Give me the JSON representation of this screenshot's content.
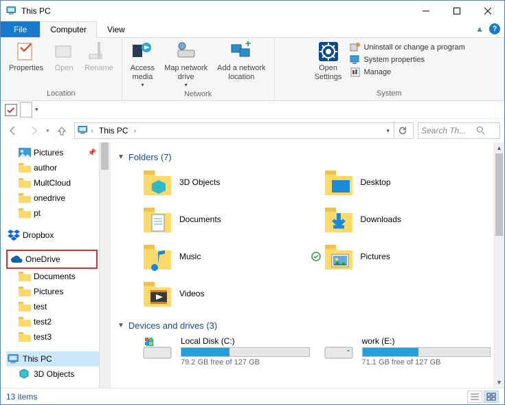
{
  "title": "This PC",
  "tabs": {
    "file": "File",
    "computer": "Computer",
    "view": "View"
  },
  "ribbon": {
    "location": {
      "label": "Location",
      "properties": "Properties",
      "open": "Open",
      "rename": "Rename"
    },
    "network": {
      "label": "Network",
      "access_media": "Access\nmedia",
      "map_drive": "Map network\ndrive",
      "add_location": "Add a network\nlocation"
    },
    "system": {
      "label": "System",
      "open_settings": "Open\nSettings",
      "uninstall": "Uninstall or change a program",
      "properties": "System properties",
      "manage": "Manage"
    }
  },
  "address": {
    "root": "This PC"
  },
  "search": {
    "placeholder": "Search Th..."
  },
  "tree": {
    "pictures": "Pictures",
    "author": "author",
    "multcloud": "MultCloud",
    "onedrive_folder": "onedrive",
    "pt": "pt",
    "dropbox": "Dropbox",
    "onedrive": "OneDrive",
    "documents": "Documents",
    "od_pictures": "Pictures",
    "test": "test",
    "test2": "test2",
    "test3": "test3",
    "thispc": "This PC",
    "objects3d": "3D Objects"
  },
  "sections": {
    "folders": "Folders (7)",
    "drives": "Devices and drives (3)"
  },
  "folders": {
    "objects3d": "3D Objects",
    "desktop": "Desktop",
    "documents": "Documents",
    "downloads": "Downloads",
    "music": "Music",
    "pictures": "Pictures",
    "videos": "Videos"
  },
  "drives": {
    "c": {
      "name": "Local Disk (C:)",
      "free": "79.2 GB free of 127 GB",
      "pct": 38
    },
    "e": {
      "name": "work (E:)",
      "free": "71.1 GB free of 127 GB",
      "pct": 44
    }
  },
  "status": {
    "items": "13 items"
  }
}
